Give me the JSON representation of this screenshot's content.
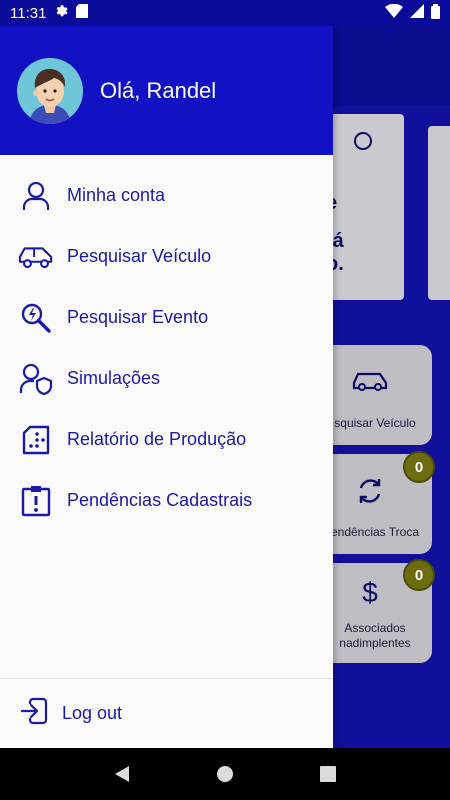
{
  "status": {
    "time": "11:31"
  },
  "drawer": {
    "greeting": "Olá, Randel",
    "items": [
      {
        "label": "Minha conta",
        "icon": "user-icon"
      },
      {
        "label": "Pesquisar Veículo",
        "icon": "car-icon"
      },
      {
        "label": "Pesquisar Evento",
        "icon": "search-event-icon"
      },
      {
        "label": "Simulações",
        "icon": "user-shield-icon"
      },
      {
        "label": "Relatório de Produção",
        "icon": "report-icon"
      },
      {
        "label": "Pendências Cadastrais",
        "icon": "alert-clipboard-icon"
      }
    ],
    "logout_label": "Log out"
  },
  "background": {
    "banner_fragments": [
      "e",
      "tá",
      "o."
    ],
    "cards": [
      {
        "label": "squisar Veículo"
      },
      {
        "label": "endências Troca",
        "badge": "0"
      },
      {
        "label": "Associados\nnadimplentes",
        "badge": "0"
      }
    ]
  },
  "colors": {
    "primary": "#1212c4",
    "text_primary": "#1a1aa6",
    "badge": "#6d6d10"
  }
}
